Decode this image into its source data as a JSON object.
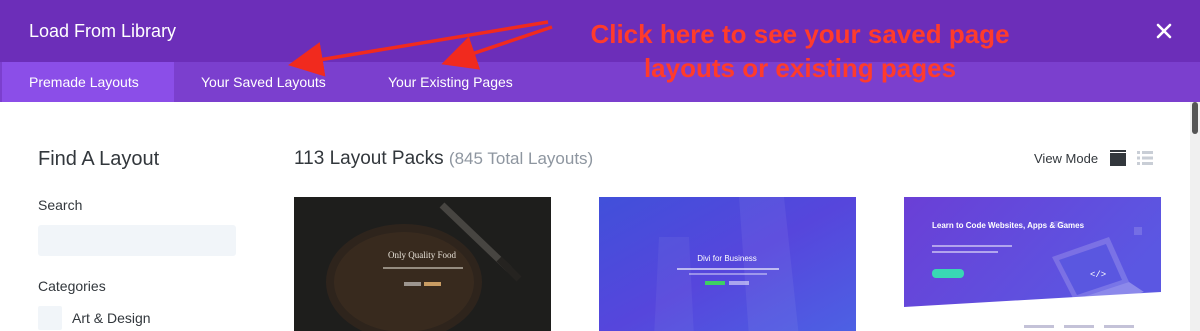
{
  "modal": {
    "title": "Load From Library",
    "close_icon": "close-icon"
  },
  "tabs": [
    {
      "label": "Premade Layouts",
      "active": true
    },
    {
      "label": "Your Saved Layouts",
      "active": false
    },
    {
      "label": "Your Existing Pages",
      "active": false
    }
  ],
  "annotation": {
    "line1": "Click here to see your saved page",
    "line2": "layouts or existing pages",
    "color": "#ff3b2b"
  },
  "sidebar": {
    "title": "Find A Layout",
    "search_label": "Search",
    "search_value": "",
    "categories_label": "Categories",
    "categories": [
      {
        "label": "Art & Design",
        "checked": false
      }
    ]
  },
  "main": {
    "title": "113 Layout Packs",
    "total": "(845 Total Layouts)",
    "view_mode_label": "View Mode"
  },
  "cards": [
    {
      "heading": "Only Quality Food"
    },
    {
      "heading": "Divi for Business"
    },
    {
      "heading": "Learn to Code Websites, Apps & Games"
    }
  ],
  "colors": {
    "header": "#6c2eb9",
    "tabs_bar": "#7b3fce",
    "active_tab": "#8b4ee8"
  }
}
